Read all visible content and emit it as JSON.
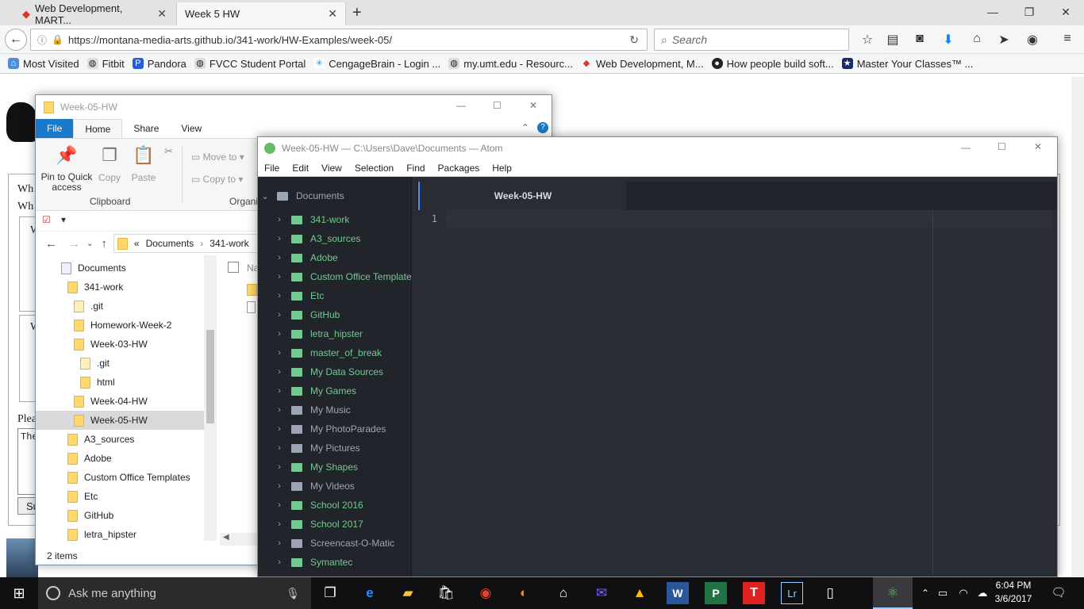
{
  "browser": {
    "tabs": [
      {
        "label": "Web Development, MART..."
      },
      {
        "label": "Week 5 HW"
      }
    ],
    "url": "https://montana-media-arts.github.io/341-work/HW-Examples/week-05/",
    "search_placeholder": "Search",
    "bookmarks": [
      {
        "label": "Most Visited"
      },
      {
        "label": "Fitbit"
      },
      {
        "label": "Pandora"
      },
      {
        "label": "FVCC Student Portal"
      },
      {
        "label": "CengageBrain - Login ..."
      },
      {
        "label": "my.umt.edu - Resourc..."
      },
      {
        "label": "Web Development, M..."
      },
      {
        "label": "How people build soft..."
      },
      {
        "label": "Master Your Classes™ ..."
      }
    ]
  },
  "page_behind": {
    "fragments": [
      "Wh",
      "Wh",
      "W",
      "W",
      "Plea",
      "The",
      "Su"
    ]
  },
  "explorer": {
    "title": "Week-05-HW",
    "tabs": [
      "File",
      "Home",
      "Share",
      "View"
    ],
    "ribbon": {
      "pin_label": "Pin to Quick access",
      "copy_label": "Copy",
      "paste_label": "Paste",
      "move_to": "Move to",
      "copy_to": "Copy to",
      "group_clipboard": "Clipboard",
      "group_organize": "Organi"
    },
    "breadcrumb": [
      "«",
      "Documents",
      "341-work"
    ],
    "column_name": "Na",
    "tree": [
      {
        "label": "Documents"
      },
      {
        "label": "341-work"
      },
      {
        "label": ".git"
      },
      {
        "label": "Homework-Week-2"
      },
      {
        "label": "Week-03-HW"
      },
      {
        "label": ".git"
      },
      {
        "label": "html"
      },
      {
        "label": "Week-04-HW"
      },
      {
        "label": "Week-05-HW"
      },
      {
        "label": "A3_sources"
      },
      {
        "label": "Adobe"
      },
      {
        "label": "Custom Office Templates"
      },
      {
        "label": "Etc"
      },
      {
        "label": "GitHub"
      },
      {
        "label": "letra_hipster"
      }
    ],
    "status": "2 items"
  },
  "atom": {
    "title": "Week-05-HW — C:\\Users\\Dave\\Documents — Atom",
    "menu": [
      "File",
      "Edit",
      "View",
      "Selection",
      "Find",
      "Packages",
      "Help"
    ],
    "root": "Documents",
    "folders": [
      {
        "label": "341-work"
      },
      {
        "label": "A3_sources"
      },
      {
        "label": "Adobe"
      },
      {
        "label": "Custom Office Templates"
      },
      {
        "label": "Etc"
      },
      {
        "label": "GitHub"
      },
      {
        "label": "letra_hipster"
      },
      {
        "label": "master_of_break"
      },
      {
        "label": "My Data Sources"
      },
      {
        "label": "My Games"
      },
      {
        "label": "My Music"
      },
      {
        "label": "My PhotoParades"
      },
      {
        "label": "My Pictures"
      },
      {
        "label": "My Shapes"
      },
      {
        "label": "My Videos"
      },
      {
        "label": "School 2016"
      },
      {
        "label": "School 2017"
      },
      {
        "label": "Screencast-O-Matic"
      },
      {
        "label": "Symantec"
      }
    ],
    "tab_label": "Week-05-HW",
    "line_number": "1"
  },
  "taskbar": {
    "search_placeholder": "Ask me anything",
    "time": "6:04 PM",
    "date": "3/6/2017"
  }
}
